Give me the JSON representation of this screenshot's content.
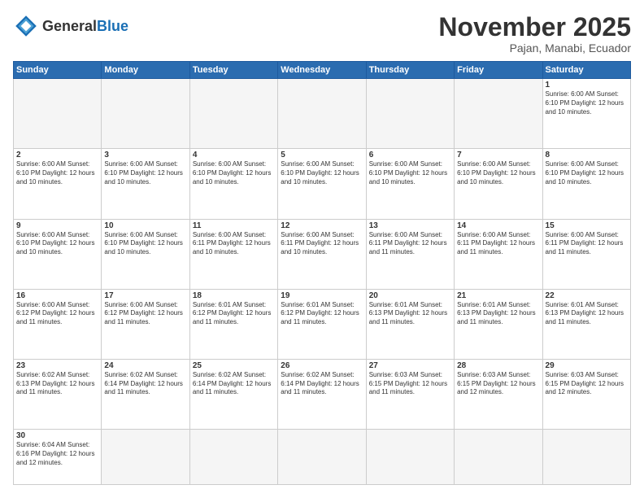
{
  "header": {
    "logo_general": "General",
    "logo_blue": "Blue",
    "month_title": "November 2025",
    "location": "Pajan, Manabi, Ecuador"
  },
  "weekdays": [
    "Sunday",
    "Monday",
    "Tuesday",
    "Wednesday",
    "Thursday",
    "Friday",
    "Saturday"
  ],
  "weeks": [
    [
      {
        "day": "",
        "info": ""
      },
      {
        "day": "",
        "info": ""
      },
      {
        "day": "",
        "info": ""
      },
      {
        "day": "",
        "info": ""
      },
      {
        "day": "",
        "info": ""
      },
      {
        "day": "",
        "info": ""
      },
      {
        "day": "1",
        "info": "Sunrise: 6:00 AM\nSunset: 6:10 PM\nDaylight: 12 hours\nand 10 minutes."
      }
    ],
    [
      {
        "day": "2",
        "info": "Sunrise: 6:00 AM\nSunset: 6:10 PM\nDaylight: 12 hours\nand 10 minutes."
      },
      {
        "day": "3",
        "info": "Sunrise: 6:00 AM\nSunset: 6:10 PM\nDaylight: 12 hours\nand 10 minutes."
      },
      {
        "day": "4",
        "info": "Sunrise: 6:00 AM\nSunset: 6:10 PM\nDaylight: 12 hours\nand 10 minutes."
      },
      {
        "day": "5",
        "info": "Sunrise: 6:00 AM\nSunset: 6:10 PM\nDaylight: 12 hours\nand 10 minutes."
      },
      {
        "day": "6",
        "info": "Sunrise: 6:00 AM\nSunset: 6:10 PM\nDaylight: 12 hours\nand 10 minutes."
      },
      {
        "day": "7",
        "info": "Sunrise: 6:00 AM\nSunset: 6:10 PM\nDaylight: 12 hours\nand 10 minutes."
      },
      {
        "day": "8",
        "info": "Sunrise: 6:00 AM\nSunset: 6:10 PM\nDaylight: 12 hours\nand 10 minutes."
      }
    ],
    [
      {
        "day": "9",
        "info": "Sunrise: 6:00 AM\nSunset: 6:10 PM\nDaylight: 12 hours\nand 10 minutes."
      },
      {
        "day": "10",
        "info": "Sunrise: 6:00 AM\nSunset: 6:10 PM\nDaylight: 12 hours\nand 10 minutes."
      },
      {
        "day": "11",
        "info": "Sunrise: 6:00 AM\nSunset: 6:11 PM\nDaylight: 12 hours\nand 10 minutes."
      },
      {
        "day": "12",
        "info": "Sunrise: 6:00 AM\nSunset: 6:11 PM\nDaylight: 12 hours\nand 10 minutes."
      },
      {
        "day": "13",
        "info": "Sunrise: 6:00 AM\nSunset: 6:11 PM\nDaylight: 12 hours\nand 11 minutes."
      },
      {
        "day": "14",
        "info": "Sunrise: 6:00 AM\nSunset: 6:11 PM\nDaylight: 12 hours\nand 11 minutes."
      },
      {
        "day": "15",
        "info": "Sunrise: 6:00 AM\nSunset: 6:11 PM\nDaylight: 12 hours\nand 11 minutes."
      }
    ],
    [
      {
        "day": "16",
        "info": "Sunrise: 6:00 AM\nSunset: 6:12 PM\nDaylight: 12 hours\nand 11 minutes."
      },
      {
        "day": "17",
        "info": "Sunrise: 6:00 AM\nSunset: 6:12 PM\nDaylight: 12 hours\nand 11 minutes."
      },
      {
        "day": "18",
        "info": "Sunrise: 6:01 AM\nSunset: 6:12 PM\nDaylight: 12 hours\nand 11 minutes."
      },
      {
        "day": "19",
        "info": "Sunrise: 6:01 AM\nSunset: 6:12 PM\nDaylight: 12 hours\nand 11 minutes."
      },
      {
        "day": "20",
        "info": "Sunrise: 6:01 AM\nSunset: 6:13 PM\nDaylight: 12 hours\nand 11 minutes."
      },
      {
        "day": "21",
        "info": "Sunrise: 6:01 AM\nSunset: 6:13 PM\nDaylight: 12 hours\nand 11 minutes."
      },
      {
        "day": "22",
        "info": "Sunrise: 6:01 AM\nSunset: 6:13 PM\nDaylight: 12 hours\nand 11 minutes."
      }
    ],
    [
      {
        "day": "23",
        "info": "Sunrise: 6:02 AM\nSunset: 6:13 PM\nDaylight: 12 hours\nand 11 minutes."
      },
      {
        "day": "24",
        "info": "Sunrise: 6:02 AM\nSunset: 6:14 PM\nDaylight: 12 hours\nand 11 minutes."
      },
      {
        "day": "25",
        "info": "Sunrise: 6:02 AM\nSunset: 6:14 PM\nDaylight: 12 hours\nand 11 minutes."
      },
      {
        "day": "26",
        "info": "Sunrise: 6:02 AM\nSunset: 6:14 PM\nDaylight: 12 hours\nand 11 minutes."
      },
      {
        "day": "27",
        "info": "Sunrise: 6:03 AM\nSunset: 6:15 PM\nDaylight: 12 hours\nand 11 minutes."
      },
      {
        "day": "28",
        "info": "Sunrise: 6:03 AM\nSunset: 6:15 PM\nDaylight: 12 hours\nand 12 minutes."
      },
      {
        "day": "29",
        "info": "Sunrise: 6:03 AM\nSunset: 6:15 PM\nDaylight: 12 hours\nand 12 minutes."
      }
    ],
    [
      {
        "day": "30",
        "info": "Sunrise: 6:04 AM\nSunset: 6:16 PM\nDaylight: 12 hours\nand 12 minutes."
      },
      {
        "day": "",
        "info": ""
      },
      {
        "day": "",
        "info": ""
      },
      {
        "day": "",
        "info": ""
      },
      {
        "day": "",
        "info": ""
      },
      {
        "day": "",
        "info": ""
      },
      {
        "day": "",
        "info": ""
      }
    ]
  ]
}
